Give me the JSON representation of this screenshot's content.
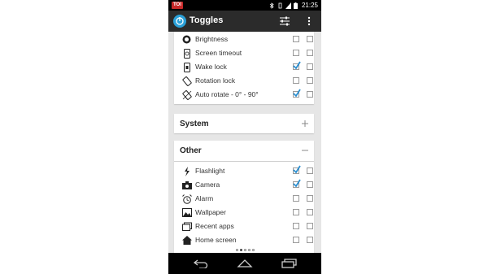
{
  "status_bar": {
    "badge": "TOI",
    "time": "21:25"
  },
  "action_bar": {
    "title": "Toggles"
  },
  "top_card": {
    "items": [
      {
        "label": "Brightness",
        "icon": "brightness-icon",
        "c1": false,
        "c2": false
      },
      {
        "label": "Screen timeout",
        "icon": "screen-timeout-icon",
        "c1": false,
        "c2": false
      },
      {
        "label": "Wake lock",
        "icon": "wake-lock-icon",
        "c1": true,
        "c2": false
      },
      {
        "label": "Rotation lock",
        "icon": "rotation-lock-icon",
        "c1": false,
        "c2": false
      },
      {
        "label": "Auto rotate - 0° - 90°",
        "icon": "auto-rotate-icon",
        "c1": true,
        "c2": false
      }
    ]
  },
  "system_section": {
    "title": "System",
    "toggle": "+"
  },
  "other_section": {
    "title": "Other",
    "toggle": "−",
    "items": [
      {
        "label": "Flashlight",
        "icon": "flashlight-icon",
        "c1": true,
        "c2": false
      },
      {
        "label": "Camera",
        "icon": "camera-icon",
        "c1": true,
        "c2": false
      },
      {
        "label": "Alarm",
        "icon": "alarm-icon",
        "c1": false,
        "c2": false
      },
      {
        "label": "Wallpaper",
        "icon": "wallpaper-icon",
        "c1": false,
        "c2": false
      },
      {
        "label": "Recent apps",
        "icon": "recent-apps-icon",
        "c1": false,
        "c2": false
      },
      {
        "label": "Home screen",
        "icon": "home-screen-icon",
        "c1": false,
        "c2": false
      }
    ]
  },
  "pager": {
    "count": 5,
    "active": 1
  },
  "colors": {
    "accent": "#2aa0d8",
    "action_bar": "#2b2b2b",
    "background": "#e6e6e6"
  }
}
